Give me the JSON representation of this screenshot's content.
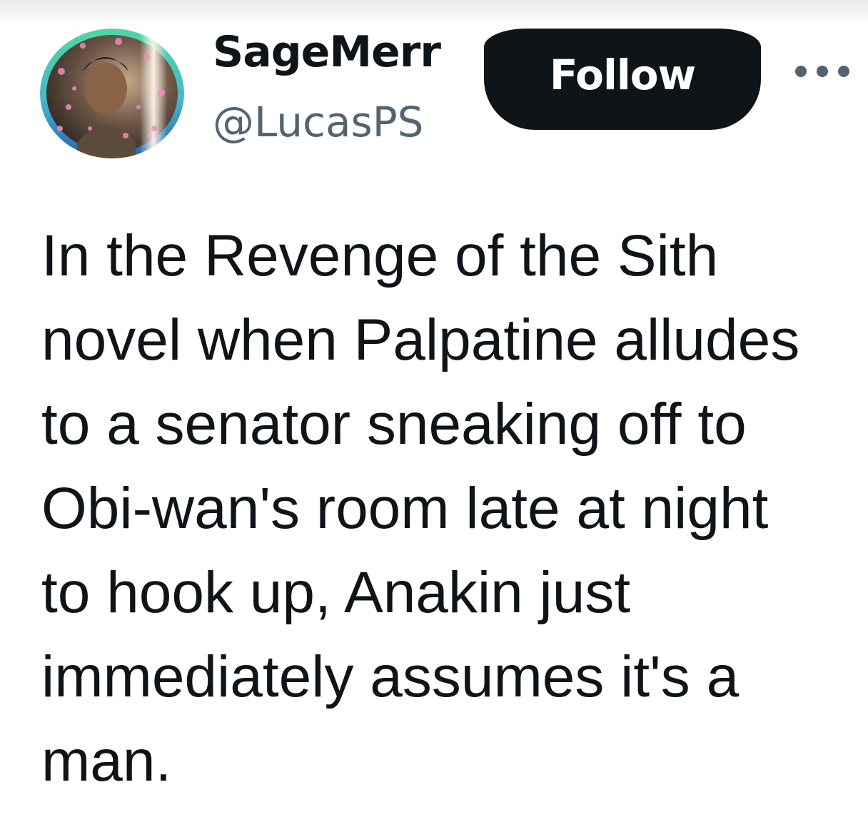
{
  "author": {
    "display_name": "SageMerr",
    "handle": "@LucasPS",
    "avatar_icon": "profile-avatar"
  },
  "actions": {
    "follow_label": "Follow",
    "more_icon": "more-dots-icon"
  },
  "tweet": {
    "text": "In the Revenge of the Sith\nnovel when Palpatine alludes\nto a senator sneaking off to\nObi-wan's room late at night\nto hook up, Anakin just\nimmediately assumes it's a\nman."
  },
  "colors": {
    "primary_text": "#0f1419",
    "secondary_text": "#536471",
    "button_bg": "#0f1419",
    "button_text": "#ffffff",
    "avatar_ring_teal": "#3ecf9a",
    "avatar_ring_blue": "#2d6fb8"
  }
}
